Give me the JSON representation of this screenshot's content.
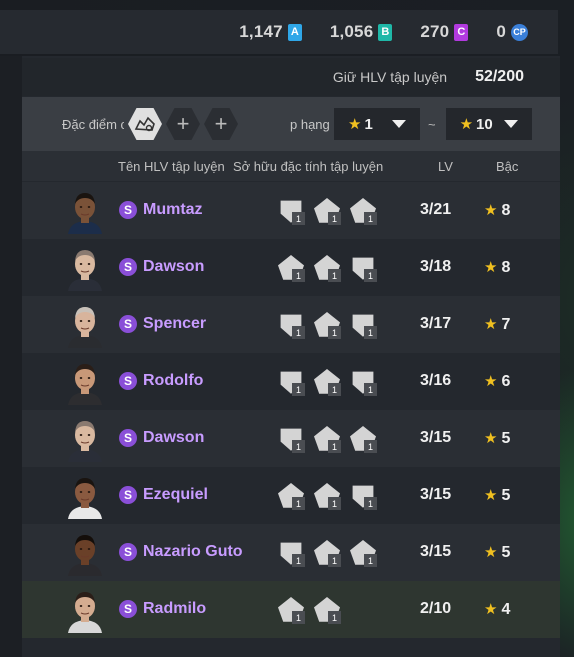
{
  "currencies": [
    {
      "value": "1,147",
      "badge": "A",
      "color": "#2fa7e8",
      "kind": "square"
    },
    {
      "value": "1,056",
      "badge": "B",
      "color": "#1fb8a8",
      "kind": "square"
    },
    {
      "value": "270",
      "badge": "C",
      "color": "#b23adf",
      "kind": "square"
    },
    {
      "value": "0",
      "badge": "CP",
      "color": "#3a7fd8",
      "kind": "coin"
    }
  ],
  "holding": {
    "label": "Giữ HLV tập luyện",
    "value": "52/200"
  },
  "filters": {
    "trait_label": "Đặc điểm c",
    "add_symbol": "+",
    "rank_label": "p hạng",
    "rank_min": "1",
    "rank_max": "10",
    "tilde": "~",
    "star": "★"
  },
  "table": {
    "headers": {
      "name": "Tên HLV tập luyện",
      "traits": "Sở hữu đặc tính tập luyện",
      "lv": "LV",
      "tier": "Bậc"
    },
    "rows": [
      {
        "badge": "S",
        "name": "Mumtaz",
        "traits": [
          {
            "lvl": "1",
            "shape": "shield"
          },
          {
            "lvl": "1",
            "shape": "kite"
          },
          {
            "lvl": "1",
            "shape": "kite"
          }
        ],
        "lv": "3/21",
        "tier": "8",
        "skin": "#7a5238",
        "hair": "#1a1410",
        "shirt": "#1c2d4a"
      },
      {
        "badge": "S",
        "name": "Dawson",
        "traits": [
          {
            "lvl": "1",
            "shape": "kite"
          },
          {
            "lvl": "1",
            "shape": "kite"
          },
          {
            "lvl": "1",
            "shape": "shield"
          }
        ],
        "lv": "3/18",
        "tier": "8",
        "skin": "#d9b9a0",
        "hair": "#8a7a70",
        "shirt": "#2a2e38"
      },
      {
        "badge": "S",
        "name": "Spencer",
        "traits": [
          {
            "lvl": "1",
            "shape": "shield"
          },
          {
            "lvl": "1",
            "shape": "kite"
          },
          {
            "lvl": "1",
            "shape": "shield"
          }
        ],
        "lv": "3/17",
        "tier": "7",
        "skin": "#d8b49c",
        "hair": "#c8c0b8",
        "shirt": "#2a2c30"
      },
      {
        "badge": "S",
        "name": "Rodolfo",
        "traits": [
          {
            "lvl": "1",
            "shape": "shield"
          },
          {
            "lvl": "1",
            "shape": "kite"
          },
          {
            "lvl": "1",
            "shape": "shield"
          }
        ],
        "lv": "3/16",
        "tier": "6",
        "skin": "#c89878",
        "hair": "#2a1e18",
        "shirt": "#2d2d30"
      },
      {
        "badge": "S",
        "name": "Dawson",
        "traits": [
          {
            "lvl": "1",
            "shape": "shield"
          },
          {
            "lvl": "1",
            "shape": "kite"
          },
          {
            "lvl": "1",
            "shape": "kite"
          }
        ],
        "lv": "3/15",
        "tier": "5",
        "skin": "#d9b9a0",
        "hair": "#8a7a70",
        "shirt": "#2a2e38"
      },
      {
        "badge": "S",
        "name": "Ezequiel",
        "traits": [
          {
            "lvl": "1",
            "shape": "kite"
          },
          {
            "lvl": "1",
            "shape": "kite"
          },
          {
            "lvl": "1",
            "shape": "shield"
          }
        ],
        "lv": "3/15",
        "tier": "5",
        "skin": "#8a5a40",
        "hair": "#1a1410",
        "shirt": "#e8e8e8"
      },
      {
        "badge": "S",
        "name": "Nazario Guto",
        "traits": [
          {
            "lvl": "1",
            "shape": "shield"
          },
          {
            "lvl": "1",
            "shape": "kite"
          },
          {
            "lvl": "1",
            "shape": "kite"
          }
        ],
        "lv": "3/15",
        "tier": "5",
        "skin": "#6a4028",
        "hair": "#140e0a",
        "shirt": "#2a2a2e"
      },
      {
        "badge": "S",
        "name": "Radmilo",
        "traits": [
          {
            "lvl": "1",
            "shape": "kite"
          },
          {
            "lvl": "1",
            "shape": "kite"
          }
        ],
        "lv": "2/10",
        "tier": "4",
        "skin": "#d4ac90",
        "hair": "#2a1e18",
        "shirt": "#d8d8d8"
      }
    ]
  }
}
